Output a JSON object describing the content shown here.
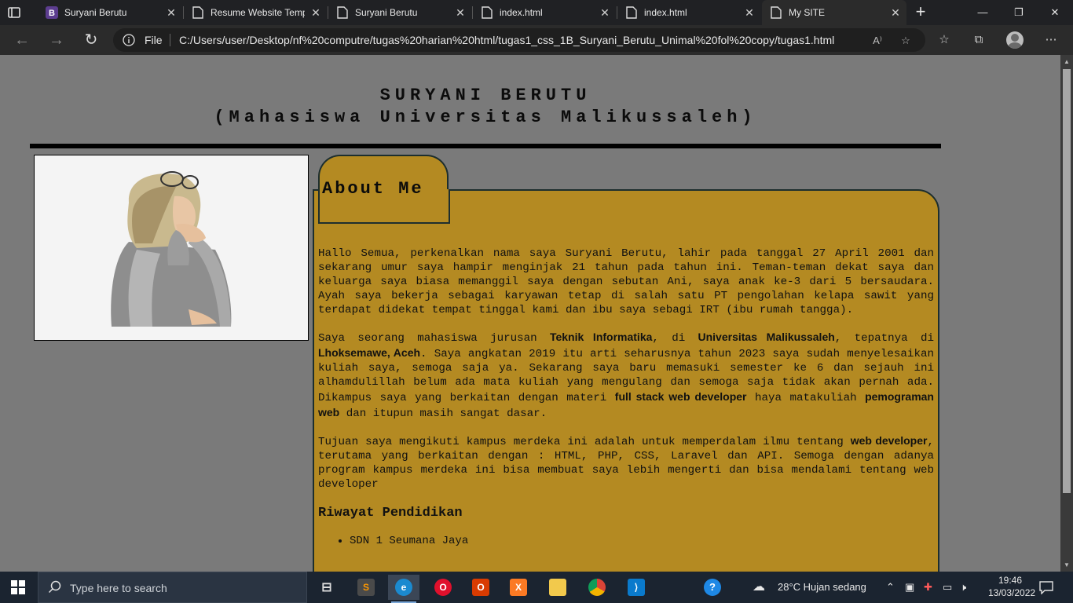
{
  "browser": {
    "tabs": [
      {
        "title": "Suryani Berutu",
        "favicon": "bootstrap-icon",
        "active": false
      },
      {
        "title": "Resume Website Temp",
        "favicon": "document-icon",
        "active": false
      },
      {
        "title": "Suryani Berutu",
        "favicon": "document-icon",
        "active": false
      },
      {
        "title": "index.html",
        "favicon": "document-icon",
        "active": false
      },
      {
        "title": "index.html",
        "favicon": "document-icon",
        "active": false
      },
      {
        "title": "My SITE",
        "favicon": "document-icon",
        "active": true
      }
    ],
    "address": {
      "scheme_label": "File",
      "url": "C:/Users/user/Desktop/nf%20computre/tugas%20harian%20html/tugas1_css_1B_Suryani_Berutu_Unimal%20fol%20copy/tugas1.html"
    }
  },
  "page": {
    "header_line1": "SURYANI BERUTU",
    "header_line2": "(Mahasiswa Universitas Malikussaleh)",
    "about_title": "About Me",
    "p1": "Hallo Semua, perkenalkan nama saya Suryani Berutu, lahir pada tanggal 27 April 2001 dan sekarang umur saya hampir menginjak 21 tahun pada tahun ini. Teman-teman dekat saya dan keluarga saya biasa memanggil saya dengan sebutan Ani, saya anak ke-3 dari 5 bersaudara. Ayah saya bekerja sebagai karyawan tetap di salah satu PT pengolahan kelapa sawit yang terdapat didekat tempat tinggal kami dan ibu saya sebagi IRT (ibu rumah tangga).",
    "p2": {
      "t1": "Saya seorang mahasiswa jurusan ",
      "b1": "Teknik Informatika",
      "t2": ", di ",
      "b2": "Universitas Malikussaleh",
      "t3": ", tepatnya di ",
      "b3": "Lhoksemawe, Aceh",
      "t4": ". Saya angkatan 2019 itu arti seharusnya tahun 2023 saya sudah menyelesaikan kuliah saya, semoga saja ya. Sekarang saya baru memasuki semester ke 6 dan sejauh ini alhamdulillah belum ada mata kuliah yang mengulang dan semoga saja tidak akan pernah ada. Dikampus saya yang berkaitan dengan materi ",
      "b4": "full stack web developer",
      "t5": " haya matakuliah ",
      "b5": "pemograman web",
      "t6": " dan itupun masih sangat dasar."
    },
    "p3": {
      "t1": "Tujuan saya mengikuti kampus merdeka ini adalah untuk memperdalam ilmu tentang ",
      "b1": "web developer",
      "t2": ", terutama yang berkaitan dengan : HTML, PHP, CSS, Laravel dan API. Semoga dengan adanya program kampus merdeka ini bisa membuat saya lebih mengerti dan bisa mendalami tentang web developer"
    },
    "education_title": "Riwayat Pendidikan",
    "education": [
      "SDN 1 Seumana Jaya"
    ]
  },
  "taskbar": {
    "search_placeholder": "Type here to search",
    "weather": "28°C  Hujan sedang",
    "time": "19:46",
    "date": "13/03/2022"
  },
  "colors": {
    "panel": "#b48a22",
    "page_bg": "#7a7a7a"
  }
}
